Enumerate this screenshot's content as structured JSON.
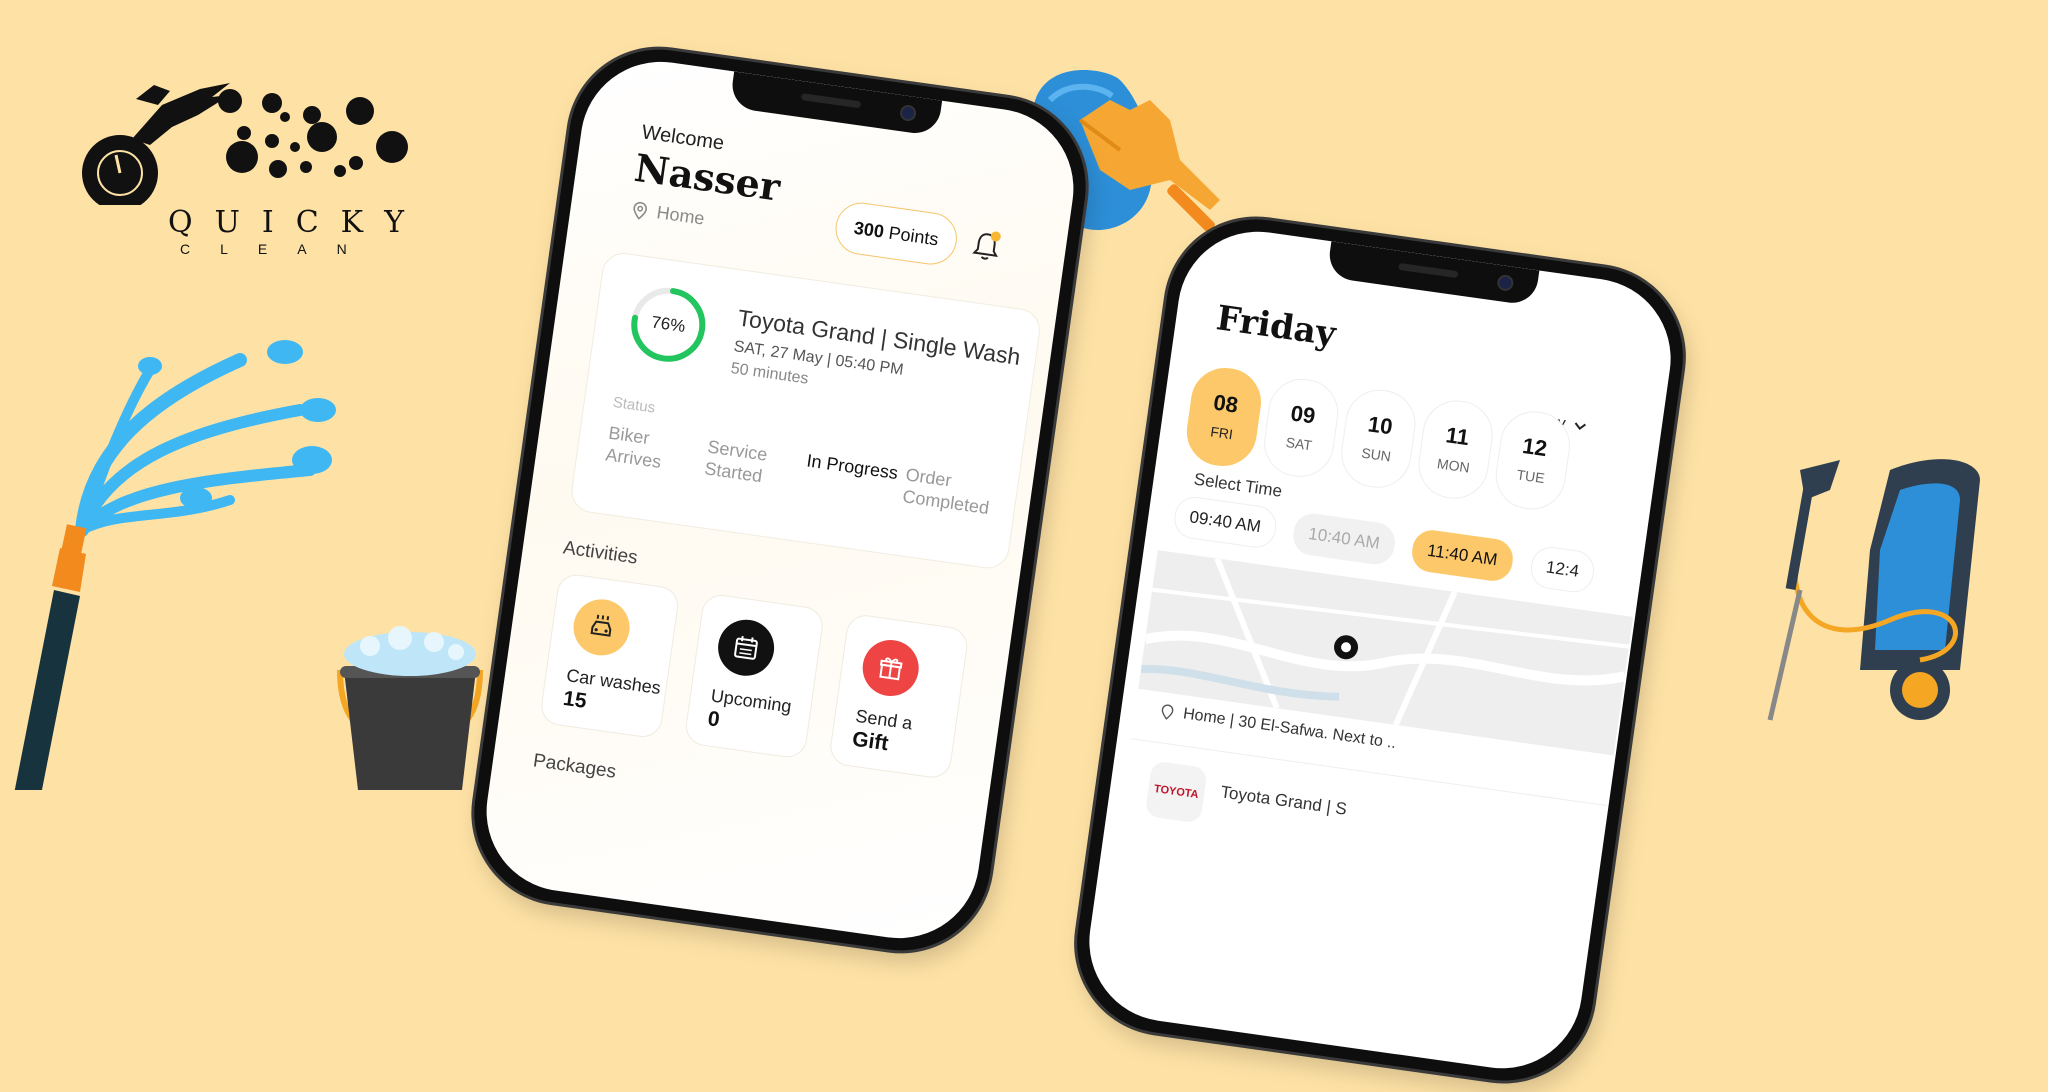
{
  "brand": {
    "name": "QUICKY",
    "tagline": "CLEAN"
  },
  "colors": {
    "background": "#FEE2A5",
    "accent": "#FCC869",
    "progress": "#22C55E",
    "gift": "#EF4444"
  },
  "home": {
    "welcome": "Welcome",
    "user_name": "Nasser",
    "location": "Home",
    "points_value": "300",
    "points_label": "Points",
    "order": {
      "progress_label": "76%",
      "progress": 0.76,
      "title": "Toyota Grand | Single Wash",
      "date_time": "SAT, 27 May  |  05:40 PM",
      "duration": "50 minutes",
      "status_label": "Status",
      "steps": [
        {
          "label": "Biker Arrives"
        },
        {
          "label": "Service Started"
        },
        {
          "label": "In Progress"
        },
        {
          "label": "Order Completed"
        }
      ]
    },
    "activities_title": "Activities",
    "activities": [
      {
        "label": "Car washes",
        "value": "15"
      },
      {
        "label": "Upcoming",
        "value": "0"
      },
      {
        "label": "Send a",
        "value": "Gift"
      }
    ],
    "packages_title": "Packages"
  },
  "schedule": {
    "day_title": "Friday",
    "month": "May",
    "dates": [
      {
        "num": "08",
        "day": "FRI"
      },
      {
        "num": "09",
        "day": "SAT"
      },
      {
        "num": "10",
        "day": "SUN"
      },
      {
        "num": "11",
        "day": "MON"
      },
      {
        "num": "12",
        "day": "TUE"
      }
    ],
    "select_time_label": "Select Time",
    "times": [
      "09:40 AM",
      "10:40 AM",
      "11:40 AM",
      "12:4"
    ],
    "address": "Home | 30 El-Safwa. Next to ..",
    "car_brand": "TOYOTA",
    "car_name": "Toyota Grand | S"
  }
}
